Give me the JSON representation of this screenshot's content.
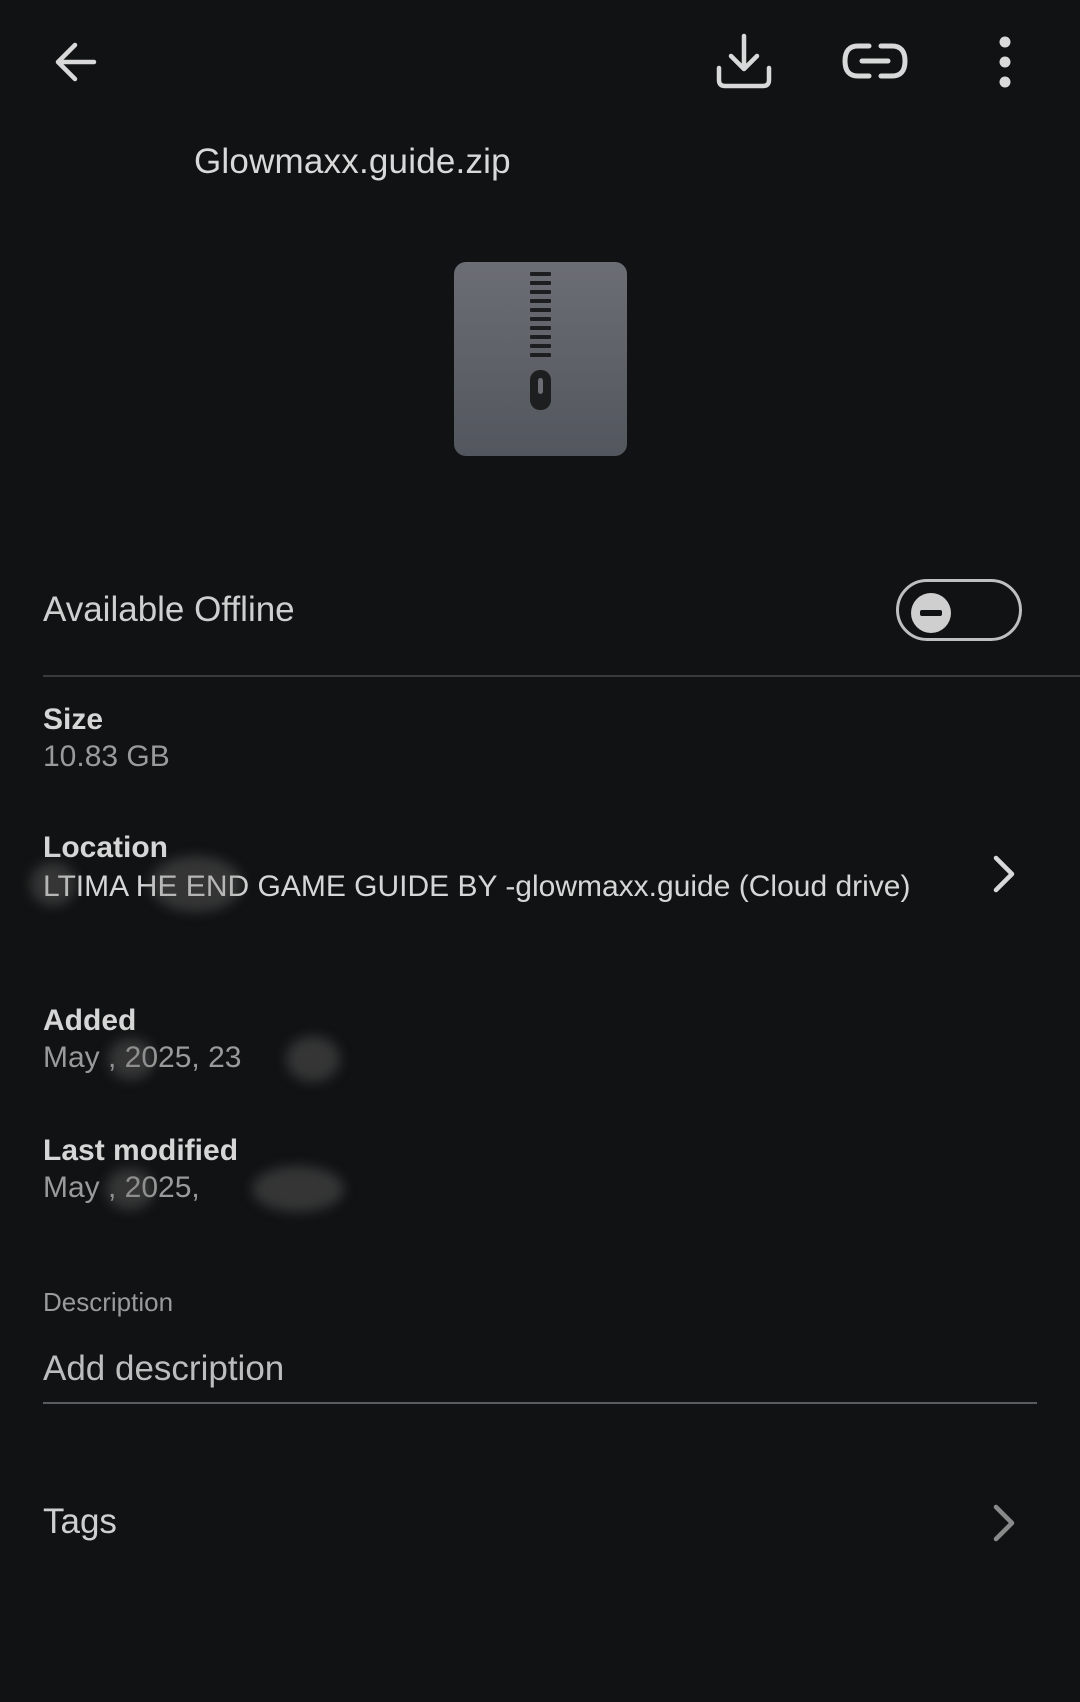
{
  "toolbar": {
    "back_icon": "arrow-back-icon",
    "download_icon": "download-icon",
    "link_icon": "link-icon",
    "more_icon": "more-vert-icon"
  },
  "file": {
    "name": "Glowmaxx.guide.zip",
    "icon": "zip-file-icon"
  },
  "offline": {
    "label": "Available Offline",
    "enabled": false
  },
  "properties": {
    "size_label": "Size",
    "size_value": "10.83 GB",
    "location_label": "Location",
    "location_value": "LTIMA HE END GAME GUIDE BY -glowmaxx.guide (Cloud drive)",
    "added_label": "Added",
    "added_value": "May , 2025, 23",
    "modified_label": "Last modified",
    "modified_value": "May , 2025,"
  },
  "description": {
    "caption": "Description",
    "placeholder": "Add description",
    "value": ""
  },
  "tags": {
    "label": "Tags"
  },
  "colors": {
    "background": "#111213",
    "text_primary": "#d6d6d6",
    "text_secondary": "#9a9a9a",
    "zip_tile": "#5f6269"
  }
}
